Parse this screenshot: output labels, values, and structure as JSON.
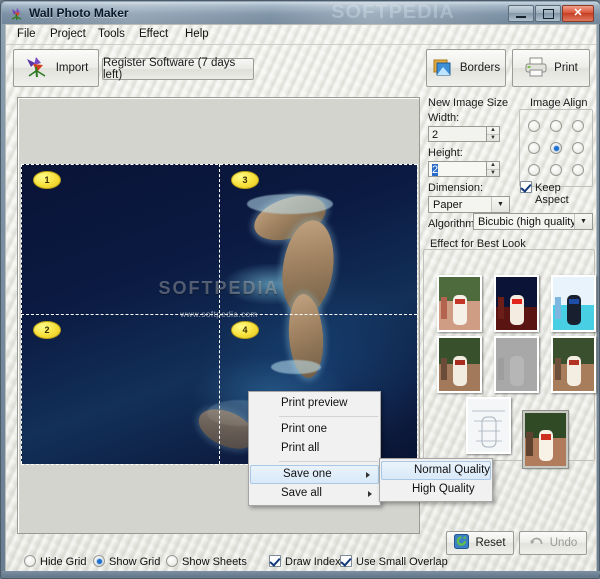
{
  "window": {
    "title": "Wall Photo Maker",
    "icon": "flower-app-icon",
    "watermark": "SOFTPEDIA",
    "buttons": {
      "minimize": "minimize-icon",
      "maximize": "maximize-icon",
      "close": "close-icon"
    }
  },
  "menubar": {
    "items": [
      {
        "label": "File"
      },
      {
        "label": "Project"
      },
      {
        "label": "Tools"
      },
      {
        "label": "Effect"
      },
      {
        "label": "Help"
      }
    ]
  },
  "toolbar": {
    "import_label": "Import",
    "register_label": "Register Software (7 days left)",
    "borders_label": "Borders",
    "print_label": "Print"
  },
  "canvas": {
    "watermark_title": "SOFTPEDIA",
    "watermark_url": "www.softpedia.com",
    "sheet_badges": [
      "1",
      "3",
      "2",
      "4"
    ]
  },
  "new_image_size": {
    "group_title": "New Image Size",
    "width_label": "Width:",
    "width_value": "2",
    "height_label": "Height:",
    "height_value": "2",
    "dimension_label": "Dimension:",
    "dimension_value": "Paper",
    "dimension_options": [
      "Paper"
    ]
  },
  "image_align": {
    "group_title": "Image Align",
    "selected_index": 4,
    "keep_aspect_label": "Keep Aspect",
    "keep_aspect_checked": true
  },
  "algorithm": {
    "label": "Algorithm:",
    "value": "Bicubic (high quality)",
    "options": [
      "Bicubic (high quality)"
    ]
  },
  "effects": {
    "group_title": "Effect for Best Look",
    "items": [
      {
        "name": "effect-original"
      },
      {
        "name": "effect-night"
      },
      {
        "name": "effect-negative"
      },
      {
        "name": "effect-warm"
      },
      {
        "name": "effect-emboss"
      },
      {
        "name": "effect-sepia"
      },
      {
        "name": "effect-sketch"
      },
      {
        "name": "effect-vivid"
      }
    ],
    "selected_index": 7
  },
  "context_menu": {
    "items": [
      {
        "label": "Print preview",
        "submenu": false,
        "highlighted": false
      },
      {
        "label": "Print one",
        "submenu": false,
        "highlighted": false
      },
      {
        "label": "Print all",
        "submenu": false,
        "highlighted": false
      },
      {
        "label": "Save one",
        "submenu": true,
        "highlighted": true
      },
      {
        "label": "Save all",
        "submenu": true,
        "highlighted": false
      }
    ],
    "submenu": {
      "items": [
        {
          "label": "Normal Quality",
          "highlighted": true
        },
        {
          "label": "High Quality",
          "highlighted": false
        }
      ]
    }
  },
  "bottom": {
    "hide_grid_label": "Hide Grid",
    "show_grid_label": "Show Grid",
    "show_sheets_label": "Show Sheets",
    "grid_selected": "show_grid",
    "draw_index_label": "Draw Index",
    "draw_index_checked": true,
    "use_small_overlap_label": "Use Small Overlap",
    "use_small_overlap_checked": true,
    "reset_label": "Reset",
    "undo_label": "Undo",
    "undo_disabled": true
  },
  "colors": {
    "accent": "#1d6fd0",
    "close_button": "#c43c22",
    "badge": "#f7e03a",
    "menu_highlight": "#d9e9f8"
  }
}
